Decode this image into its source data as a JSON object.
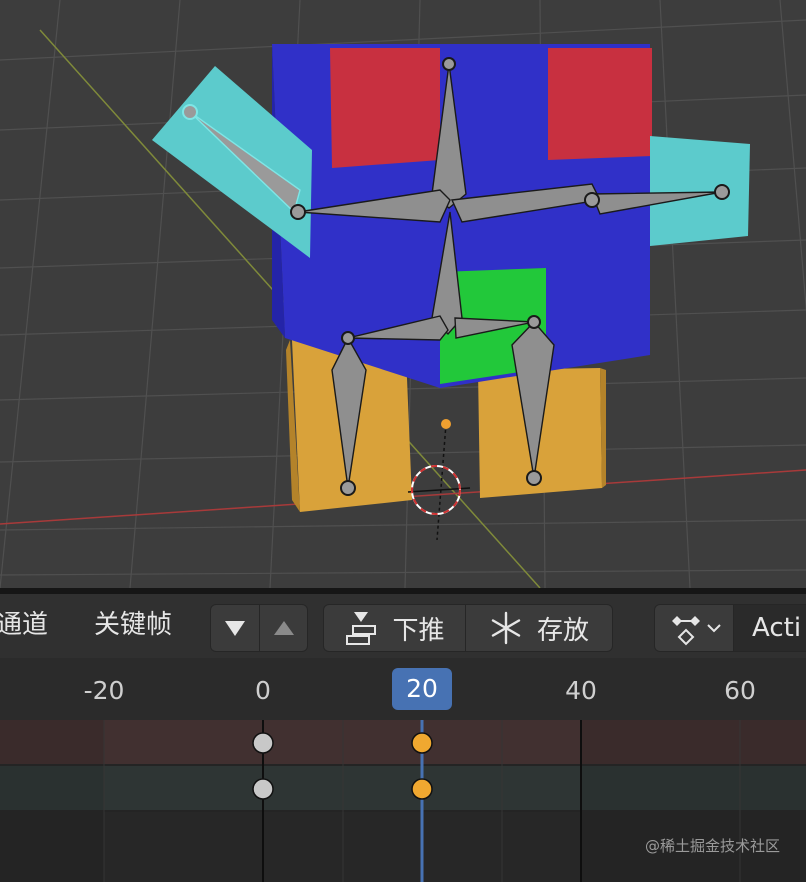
{
  "toolbar": {
    "channel_menu": "通道",
    "keyframe_menu": "关键帧",
    "push_down_label": "下推",
    "stash_label": "存放",
    "action_label": "Acti"
  },
  "timeline": {
    "ticks": [
      "-20",
      "0",
      "20",
      "40",
      "60"
    ],
    "current_frame": "20",
    "keyframes": [
      {
        "track": 1,
        "frame": 0,
        "selected": false
      },
      {
        "track": 1,
        "frame": 20,
        "selected": true
      },
      {
        "track": 2,
        "frame": 0,
        "selected": false
      },
      {
        "track": 2,
        "frame": 20,
        "selected": true
      }
    ]
  },
  "watermark": "@稀土掘金技术社区",
  "colors": {
    "accent": "#4772b3",
    "keyframe_selected": "#f0a830",
    "keyframe_unselected": "#c8c8c8",
    "body_blue": "#3030c8",
    "face_red": "#c83040",
    "arm_cyan": "#5ccbcc",
    "leg_orange": "#d9a23a",
    "mouth_green": "#22c83a"
  },
  "icons": [
    "down-arrow-icon",
    "up-arrow-icon",
    "push-down-icon",
    "snowflake-icon",
    "action-icon",
    "chevron-down-icon"
  ]
}
